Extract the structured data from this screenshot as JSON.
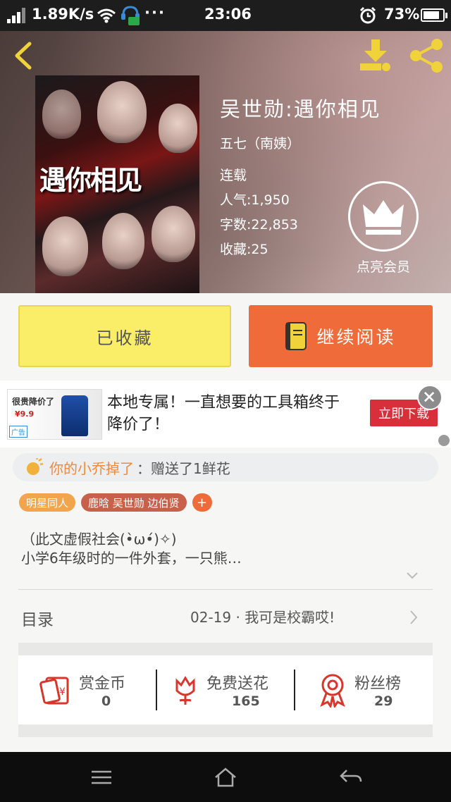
{
  "status_bar": {
    "speed": "1.89K/s",
    "dots": "···",
    "time": "23:06",
    "battery": "73%"
  },
  "book": {
    "title": "吴世勋:遇你相见",
    "author": "五七（南姨）",
    "status": "连载",
    "popularity": "人气:1,950",
    "word_count": "字数:22,853",
    "favorites": "收藏:25",
    "cover_title": "遇你相见"
  },
  "vip": {
    "label": "点亮会员"
  },
  "actions": {
    "collect": "已收藏",
    "read": "继续阅读"
  },
  "ad": {
    "image_line1": "很贵降价了",
    "image_price": "¥9.9",
    "image_tag": "广告",
    "text": "本地专属！一直想要的工具箱终于降价了！",
    "button": "立即下载"
  },
  "notice": {
    "name": "你的小乔掉了",
    "message": "：赠送了1鲜花"
  },
  "tags": [
    "明星同人",
    "鹿晗 吴世勋 边伯贤",
    "+"
  ],
  "description": {
    "line1": "（此文虚假社会(•̀ω•́)✧)",
    "line2": "小学6年级时的一件外套，一只熊…"
  },
  "toc": {
    "label": "目录",
    "latest": "02-19 · 我可是校霸哎!"
  },
  "stats": [
    {
      "label": "赏金币",
      "value": "0",
      "icon": "red-envelope-icon"
    },
    {
      "label": "免费送花",
      "value": "165",
      "icon": "flower-icon"
    },
    {
      "label": "粉丝榜",
      "value": "29",
      "icon": "medal-icon"
    }
  ],
  "colors": {
    "accent": "#ef6b3a",
    "collect_bg": "#faee69",
    "tag_orange": "#f2a54a",
    "tag_red": "#c8614c",
    "icon_yellow": "#f0d33b"
  }
}
